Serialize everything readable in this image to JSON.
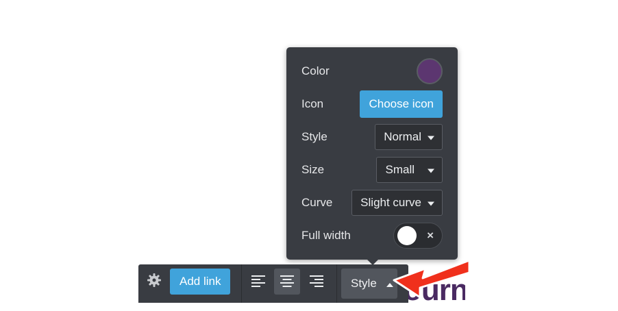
{
  "panel": {
    "color": {
      "label": "Color",
      "swatch": "#5c3670"
    },
    "icon": {
      "label": "Icon",
      "button": "Choose icon"
    },
    "style": {
      "label": "Style",
      "value": "Normal"
    },
    "size": {
      "label": "Size",
      "value": "Small"
    },
    "curve": {
      "label": "Curve",
      "value": "Slight curve"
    },
    "full_width": {
      "label": "Full width",
      "on": false,
      "off_glyph": "×"
    }
  },
  "toolbar": {
    "settings_icon": "gear-icon",
    "add_link": "Add link",
    "align": [
      "left",
      "center",
      "right"
    ],
    "align_active": "center",
    "style_button": "Style"
  },
  "background": {
    "text_fragment": "ourne"
  },
  "colors": {
    "panel_bg": "#393c42",
    "accent": "#40a3db",
    "annotation_arrow": "#f0301c"
  }
}
